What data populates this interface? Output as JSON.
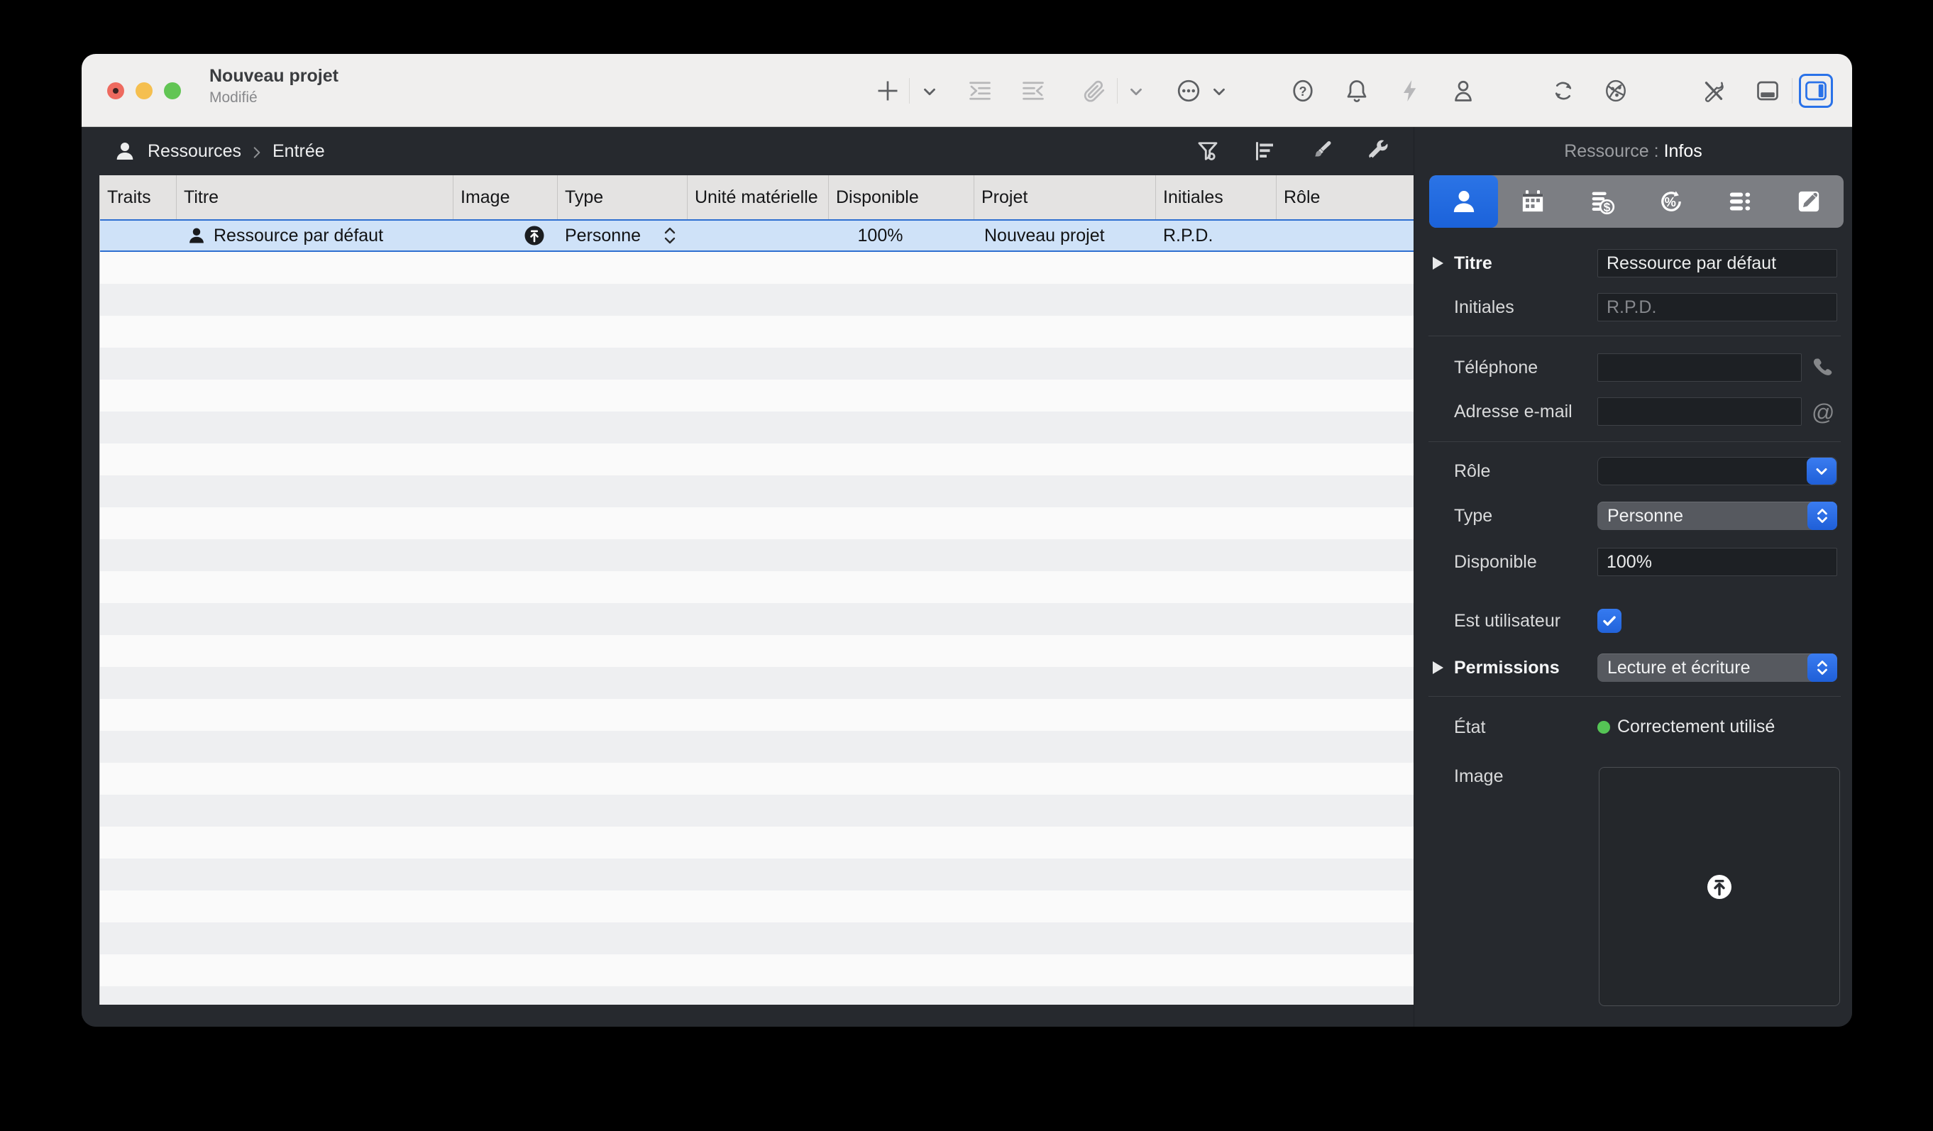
{
  "window": {
    "title": "Nouveau projet",
    "subtitle": "Modifié",
    "traffic_lights": [
      "close",
      "minimize",
      "zoom"
    ]
  },
  "toolbar": {
    "icons": [
      "add",
      "add-menu",
      "indent",
      "outdent",
      "attach",
      "attach-menu",
      "more",
      "more-menu",
      "help",
      "notifications",
      "automation",
      "account",
      "sync",
      "publish",
      "tools",
      "toggle-bottom-panel",
      "toggle-inspector"
    ],
    "active_toggle": "toggle-inspector"
  },
  "breadcrumb": {
    "icon": "resources-person",
    "items": [
      "Ressources",
      "Entrée"
    ],
    "actions": [
      "filter",
      "outline",
      "styles",
      "tools"
    ]
  },
  "table": {
    "columns": [
      "Traits",
      "Titre",
      "Image",
      "Type",
      "Unité matérielle",
      "Disponible",
      "Projet",
      "Initiales",
      "Rôle"
    ],
    "row": {
      "titre": "Ressource par défaut",
      "type": "Personne",
      "disponible": "100%",
      "projet": "Nouveau projet",
      "initiales": "R.P.D.",
      "selected": true
    }
  },
  "inspector": {
    "header": {
      "context": "Ressource :",
      "tab": "Infos"
    },
    "tabs": [
      "resource-info",
      "schedule",
      "costs",
      "utilization",
      "custom-data",
      "notes"
    ],
    "active_tab": "resource-info",
    "fields": {
      "titre": {
        "label": "Titre",
        "value": "Ressource par défaut"
      },
      "initiales": {
        "label": "Initiales",
        "placeholder": "R.P.D."
      },
      "telephone": {
        "label": "Téléphone",
        "value": ""
      },
      "email": {
        "label": "Adresse e-mail",
        "value": ""
      },
      "role": {
        "label": "Rôle",
        "value": ""
      },
      "type": {
        "label": "Type",
        "value": "Personne"
      },
      "disponible": {
        "label": "Disponible",
        "value": "100%"
      },
      "est_utilisateur": {
        "label": "Est utilisateur",
        "checked": true
      },
      "permissions": {
        "label": "Permissions",
        "value": "Lecture et écriture"
      },
      "etat": {
        "label": "État",
        "value": "Correctement utilisé"
      },
      "image": {
        "label": "Image"
      }
    }
  },
  "colors": {
    "accent": "#2368e0",
    "selection_bg": "#cfe2f8",
    "selection_border": "#2e6fd0",
    "status_green": "#55c455",
    "chrome": "#26292e",
    "toolbar_bg": "#f0efee"
  }
}
